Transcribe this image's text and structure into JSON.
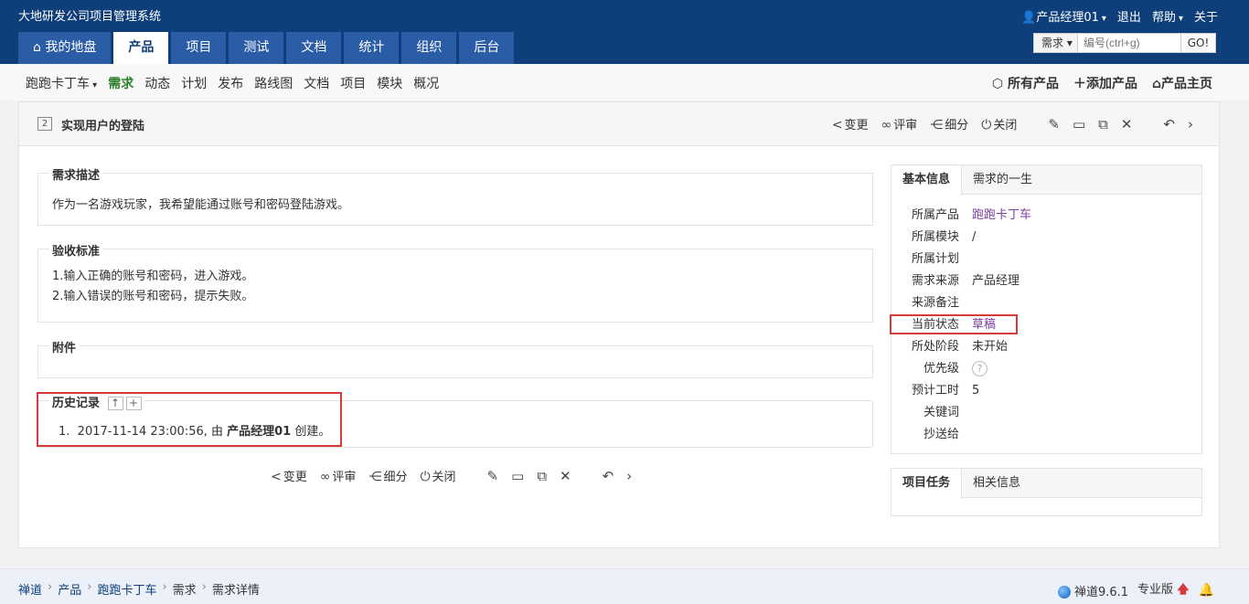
{
  "header": {
    "app_title": "大地研发公司项目管理系统",
    "user_name": "产品经理01",
    "logout": "退出",
    "help": "帮助",
    "about": "关于",
    "nav_tabs": [
      {
        "label": "我的地盘"
      },
      {
        "label": "产品"
      },
      {
        "label": "项目"
      },
      {
        "label": "测试"
      },
      {
        "label": "文档"
      },
      {
        "label": "统计"
      },
      {
        "label": "组织"
      },
      {
        "label": "后台"
      }
    ],
    "search": {
      "type_label": "需求",
      "placeholder": "编号(ctrl+g)",
      "go_label": "GO!"
    }
  },
  "sub_nav": {
    "product": "跑跑卡丁车",
    "items": [
      "需求",
      "动态",
      "计划",
      "发布",
      "路线图",
      "文档",
      "项目",
      "模块",
      "概况"
    ],
    "right": {
      "all_products": "所有产品",
      "add_product": "添加产品",
      "product_home": "产品主页"
    }
  },
  "story": {
    "id": "2",
    "title": "实现用户的登陆",
    "actions": {
      "change": "变更",
      "review": "评审",
      "subdivide": "细分",
      "close": "关闭"
    }
  },
  "sections": {
    "description": {
      "legend": "需求描述",
      "text": "作为一名游戏玩家，我希望能通过账号和密码登陆游戏。"
    },
    "verify": {
      "legend": "验收标准",
      "lines": [
        "1.输入正确的账号和密码，进入游戏。",
        "2.输入错误的账号和密码，提示失败。"
      ]
    },
    "attachments": {
      "legend": "附件"
    },
    "history": {
      "legend": "历史记录",
      "entries": [
        {
          "num": "1.",
          "time": "2017-11-14 23:00:56, 由 ",
          "actor": "产品经理01",
          "action": " 创建。"
        }
      ]
    }
  },
  "side": {
    "info_tabs": [
      "基本信息",
      "需求的一生"
    ],
    "info": [
      {
        "label": "所属产品",
        "value": "跑跑卡丁车"
      },
      {
        "label": "所属模块",
        "value": "/"
      },
      {
        "label": "所属计划",
        "value": ""
      },
      {
        "label": "需求来源",
        "value": "产品经理"
      },
      {
        "label": "来源备注",
        "value": ""
      },
      {
        "label": "当前状态",
        "value": "草稿"
      },
      {
        "label": "所处阶段",
        "value": "未开始"
      },
      {
        "label": "优先级",
        "value": "?"
      },
      {
        "label": "预计工时",
        "value": "5"
      },
      {
        "label": "关键词",
        "value": ""
      },
      {
        "label": "抄送给",
        "value": ""
      }
    ],
    "project_tabs": [
      "项目任务",
      "相关信息"
    ]
  },
  "footer": {
    "breadcrumb": [
      "禅道",
      "产品",
      "跑跑卡丁车",
      "需求",
      "需求详情"
    ],
    "version": "禅道9.6.1",
    "edition": "专业版"
  },
  "colors": {
    "header_bg": "#0e3f7b",
    "tab_bg": "#2b5da6",
    "active_sub": "#2a7f2a",
    "link_purple": "#7a3fa0",
    "highlight_red": "#d63b3b"
  }
}
